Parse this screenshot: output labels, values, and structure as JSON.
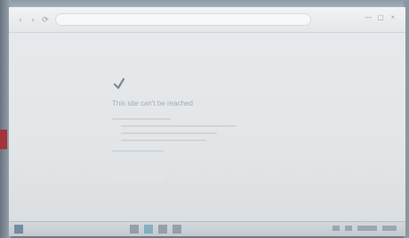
{
  "browser": {
    "address": "",
    "nav": {
      "back_glyph": "‹",
      "forward_glyph": "›",
      "reload_glyph": "⟳"
    },
    "window_controls": [
      "—",
      "▢",
      "×"
    ]
  },
  "page": {
    "icon": "warning-checkmark-icon",
    "title": "This site can't be reached"
  },
  "taskbar": {
    "icons": [
      "start-icon",
      "task-view-icon",
      "browser-icon",
      "explorer-icon",
      "store-icon"
    ]
  },
  "colors": {
    "screen_bg": "#e3e6e8",
    "taskbar": "#c8ced3",
    "active_app": "#6aa0b8"
  }
}
